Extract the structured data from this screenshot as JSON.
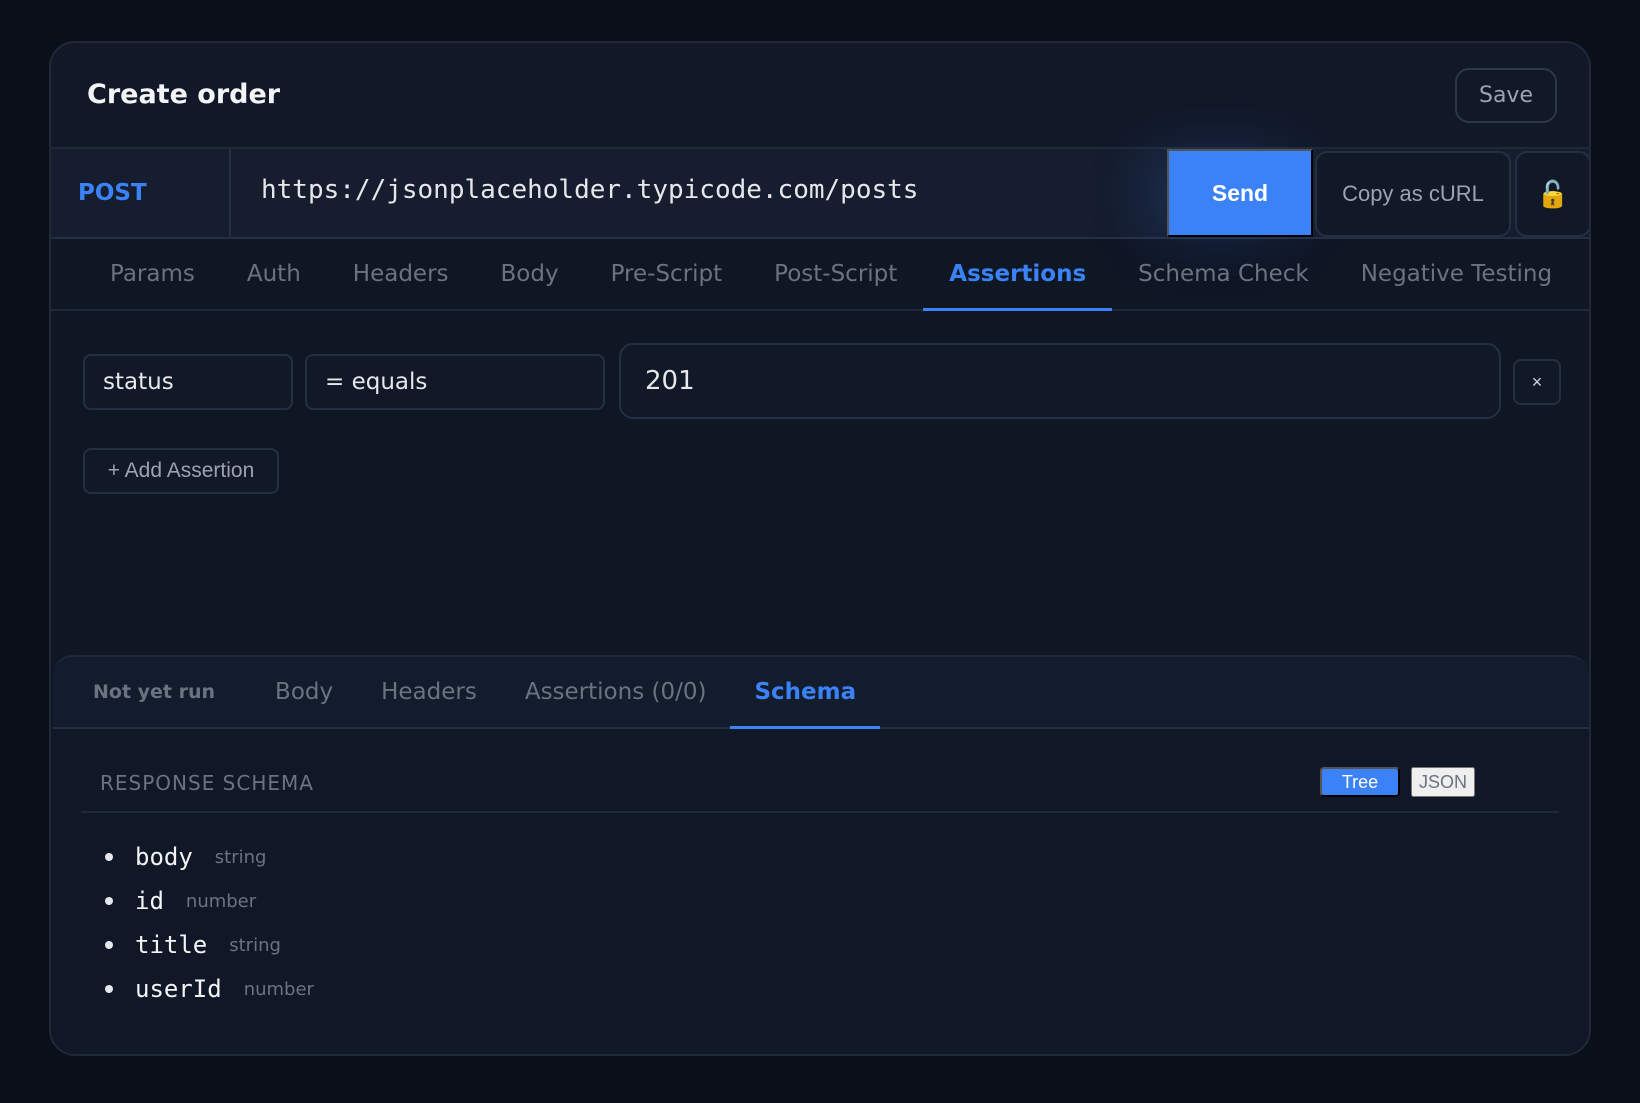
{
  "request": {
    "title": "Create order",
    "save_label": "Save",
    "method": "POST",
    "url": "https://jsonplaceholder.typicode.com/posts",
    "send_label": "Send",
    "copy_curl_label": "Copy as cURL",
    "lock_icon": "lock-icon",
    "tabs": [
      "Params",
      "Auth",
      "Headers",
      "Body",
      "Pre-Script",
      "Post-Script",
      "Assertions",
      "Schema Check",
      "Negative Testing"
    ],
    "active_tab": "Assertions"
  },
  "assertions": {
    "rows": [
      {
        "field": "status",
        "operator": "= equals",
        "value": "201",
        "remove_label": "×"
      }
    ],
    "add_label": "+ Add Assertion"
  },
  "response": {
    "status": "Not yet run",
    "tabs": [
      "Body",
      "Headers",
      "Assertions (0/0)",
      "Schema"
    ],
    "active_tab": "Schema",
    "schema_title": "RESPONSE SCHEMA",
    "view_toggle": {
      "tree": "Tree",
      "json": "JSON",
      "active": "Tree"
    },
    "schema": [
      {
        "key": "body",
        "type": "string"
      },
      {
        "key": "id",
        "type": "number"
      },
      {
        "key": "title",
        "type": "string"
      },
      {
        "key": "userId",
        "type": "number"
      }
    ]
  },
  "colors": {
    "accent": "#3b82f6",
    "background": "#0a0f1a",
    "panel": "#0f1624"
  }
}
